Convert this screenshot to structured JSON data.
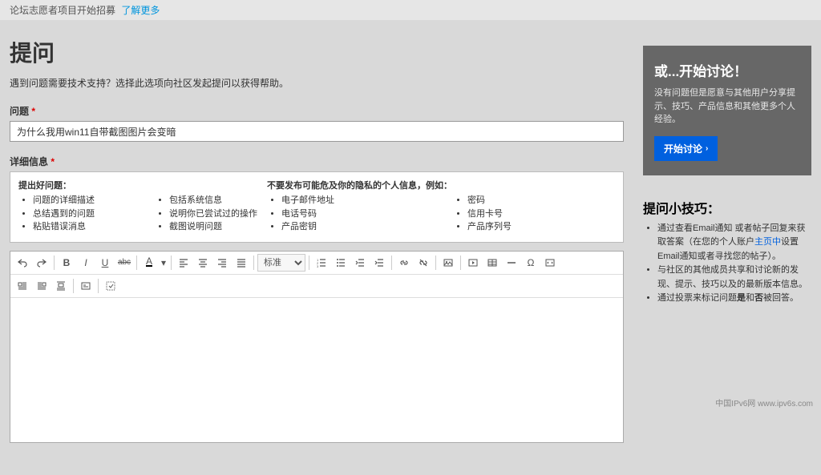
{
  "topbar": {
    "text": "论坛志愿者项目开始招募",
    "link": "了解更多"
  },
  "page": {
    "title": "提问",
    "subtitle": "遇到问题需要技术支持？选择此选项向社区发起提问以获得帮助。"
  },
  "question": {
    "label": "问题",
    "value": "为什么我用win11自带截图图片会变暗"
  },
  "details": {
    "label": "详细信息",
    "good_title": "提出好问题：",
    "good_items_a": [
      "问题的详细描述",
      "总结遇到的问题",
      "粘贴错误消息"
    ],
    "good_items_b": [
      "包括系统信息",
      "说明你已尝试过的操作",
      "截图说明问题"
    ],
    "avoid_title": "不要发布可能危及你的隐私的个人信息，例如：",
    "avoid_items_a": [
      "电子邮件地址",
      "电话号码",
      "产品密钥"
    ],
    "avoid_items_b": [
      "密码",
      "信用卡号",
      "产品序列号"
    ]
  },
  "editor": {
    "style_select": "标准"
  },
  "sidebar": {
    "discuss": {
      "title": "或...开始讨论！",
      "body": "没有问题但是愿意与其他用户分享提示、技巧、产品信息和其他更多个人经验。",
      "button": "开始讨论"
    },
    "tips": {
      "title": "提问小技巧：",
      "items": [
        {
          "pre": "通过查看Email通知 或者帖子回复来获取答案（在您的个人账户",
          "link": "主页中",
          "post": "设置Email通知或者寻找您的帖子）。"
        },
        {
          "text": "与社区的其他成员共享和讨论新的发现、提示、技巧以及的最新版本信息。"
        },
        {
          "pre": "通过投票来标记问题",
          "bold1": "是",
          "mid": "和",
          "bold2": "否",
          "post": "被回答。"
        }
      ]
    }
  },
  "footer": {
    "mark": "中国IPv6网 www.ipv6s.com"
  }
}
